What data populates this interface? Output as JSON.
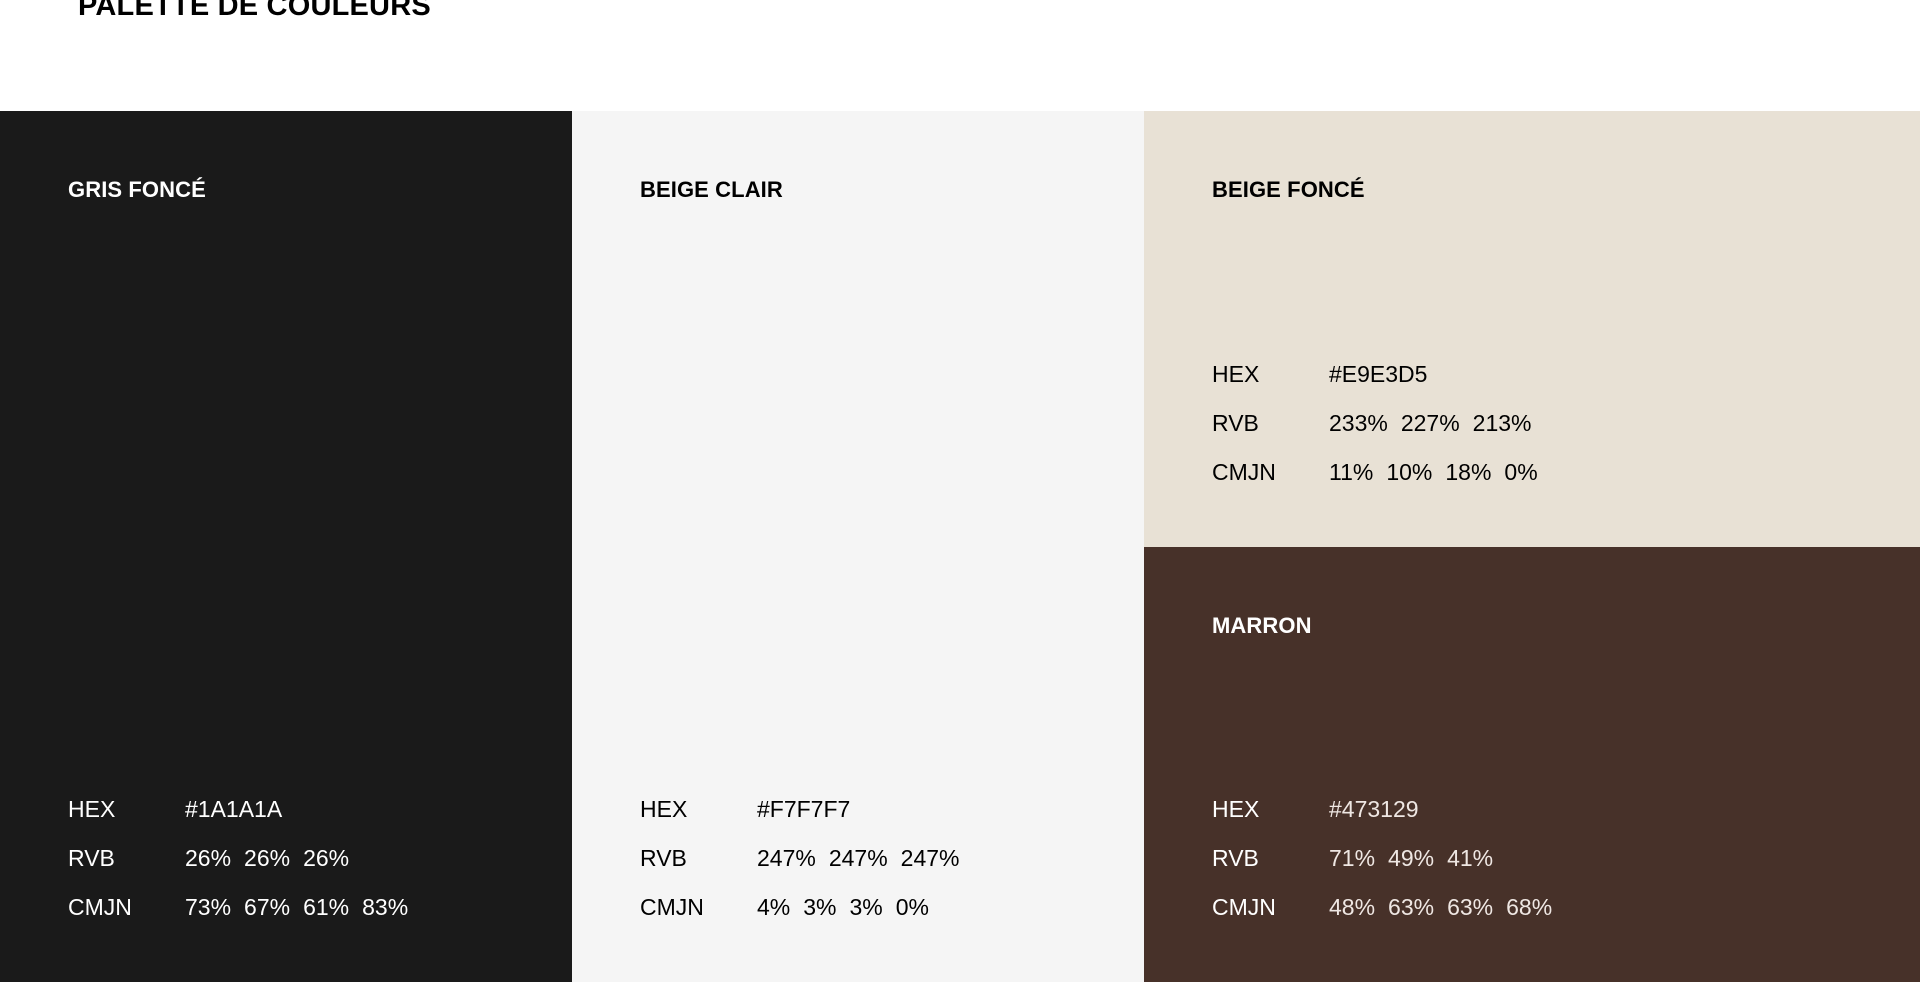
{
  "title": "PALETTE DE COULEURS",
  "colors": {
    "gris_fonce": "#1A1A1A",
    "beige_clair": "#F7F7F7",
    "beige_fonce": "#E9E3D5",
    "marron": "#473129"
  },
  "swatches": [
    {
      "name": "GRIS FONCÉ",
      "hex_label": "HEX",
      "hex": "#1A1A1A",
      "rgb_label": "RVB",
      "rgb": [
        "26%",
        "26%",
        "26%"
      ],
      "cmyk_label": "CMJN",
      "cmyk": [
        "73%",
        "67%",
        "61%",
        "83%"
      ]
    },
    {
      "name": "BEIGE CLAIR",
      "hex_label": "HEX",
      "hex": "#F7F7F7",
      "rgb_label": "RVB",
      "rgb": [
        "247%",
        "247%",
        "247%"
      ],
      "cmyk_label": "CMJN",
      "cmyk": [
        "4%",
        "3%",
        "3%",
        "0%"
      ]
    },
    {
      "name": "BEIGE FONCÉ",
      "hex_label": "HEX",
      "hex": "#E9E3D5",
      "rgb_label": "RVB",
      "rgb": [
        "233%",
        "227%",
        "213%"
      ],
      "cmyk_label": "CMJN",
      "cmyk": [
        "11%",
        "10%",
        "18%",
        "0%"
      ]
    },
    {
      "name": "MARRON",
      "hex_label": "HEX",
      "hex": "#473129",
      "rgb_label": "RVB",
      "rgb": [
        "71%",
        "49%",
        "41%"
      ],
      "cmyk_label": "CMJN",
      "cmyk": [
        "48%",
        "63%",
        "63%",
        "68%"
      ]
    }
  ]
}
